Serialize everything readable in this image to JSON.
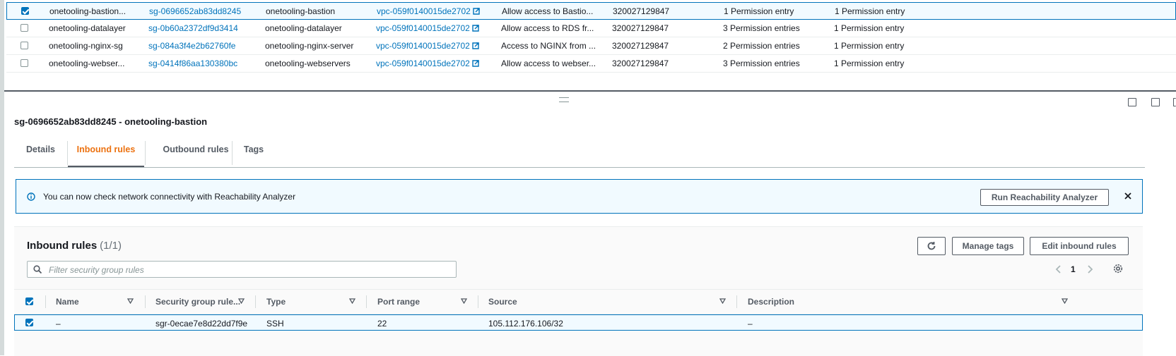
{
  "security_groups": {
    "rows": [
      {
        "selected": true,
        "name": "onetooling-bastion...",
        "sg_id": "sg-0696652ab83dd8245",
        "group_name": "onetooling-bastion",
        "vpc_id": "vpc-059f0140015de2702",
        "description": "Allow access to Bastio...",
        "owner": "320027129847",
        "inbound": "1 Permission entry",
        "outbound": "1 Permission entry"
      },
      {
        "selected": false,
        "name": "onetooling-datalayer",
        "sg_id": "sg-0b60a2372df9d3414",
        "group_name": "onetooling-datalayer",
        "vpc_id": "vpc-059f0140015de2702",
        "description": "Allow access to RDS fr...",
        "owner": "320027129847",
        "inbound": "3 Permission entries",
        "outbound": "1 Permission entry"
      },
      {
        "selected": false,
        "name": "onetooling-nginx-sg",
        "sg_id": "sg-084a3f4e2b62760fe",
        "group_name": "onetooling-nginx-server",
        "vpc_id": "vpc-059f0140015de2702",
        "description": "Access to NGINX from ...",
        "owner": "320027129847",
        "inbound": "2 Permission entries",
        "outbound": "1 Permission entry"
      },
      {
        "selected": false,
        "name": "onetooling-webser...",
        "sg_id": "sg-0414f86aa130380bc",
        "group_name": "onetooling-webservers",
        "vpc_id": "vpc-059f0140015de2702",
        "description": "Allow access to webser...",
        "owner": "320027129847",
        "inbound": "3 Permission entries",
        "outbound": "1 Permission entry"
      }
    ]
  },
  "details": {
    "title": "sg-0696652ab83dd8245 - onetooling-bastion",
    "tabs": [
      "Details",
      "Inbound rules",
      "Outbound rules",
      "Tags"
    ],
    "active_tab": "Inbound rules"
  },
  "banner": {
    "text": "You can now check network connectivity with Reachability Analyzer",
    "button": "Run Reachability Analyzer"
  },
  "inbound": {
    "title": "Inbound rules",
    "count": "(1/1)",
    "buttons": {
      "manage_tags": "Manage tags",
      "edit": "Edit inbound rules"
    },
    "search_placeholder": "Filter security group rules",
    "page": "1",
    "columns": [
      "Name",
      "Security group rule...",
      "Type",
      "Port range",
      "Source",
      "Description"
    ],
    "rows": [
      {
        "selected": true,
        "name": "–",
        "rule_id": "sgr-0ecae7e8d22dd7f9e",
        "type": "SSH",
        "port_range": "22",
        "source": "105.112.176.106/32",
        "description": "–"
      }
    ]
  },
  "colors": {
    "accent": "#0073bb",
    "active_tab": "#ec7211",
    "text": "#16191f"
  }
}
